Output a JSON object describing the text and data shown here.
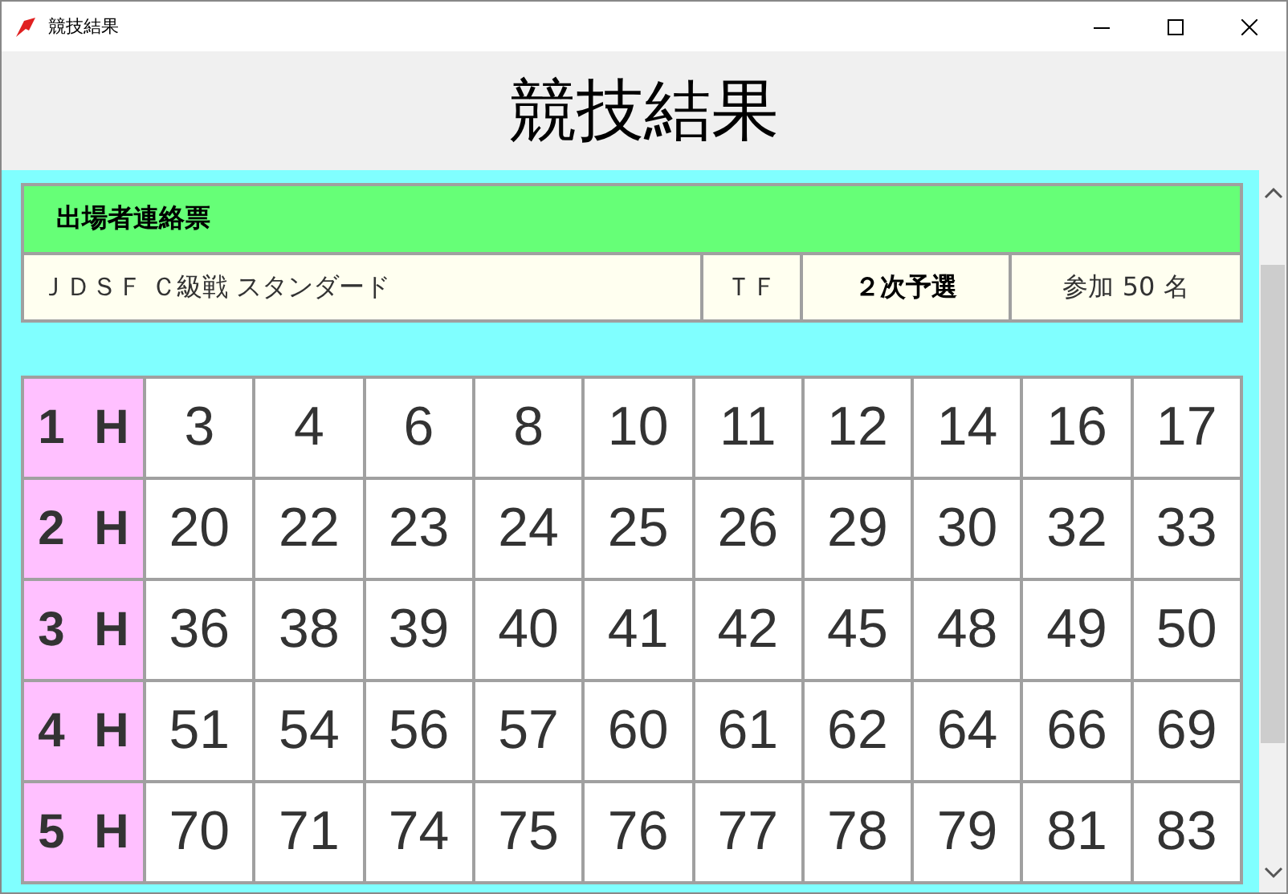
{
  "window": {
    "title": "競技結果"
  },
  "heading": "競技結果",
  "form": {
    "title": "出場者連絡票",
    "event": "ＪＤＳＦ Ｃ級戦 スタンダード",
    "code": "ＴＦ",
    "round": "２次予選",
    "entries": "参加 50 名"
  },
  "heats": [
    {
      "label": "1 H",
      "numbers": [
        "3",
        "4",
        "6",
        "8",
        "10",
        "11",
        "12",
        "14",
        "16",
        "17"
      ]
    },
    {
      "label": "2 H",
      "numbers": [
        "20",
        "22",
        "23",
        "24",
        "25",
        "26",
        "29",
        "30",
        "32",
        "33"
      ]
    },
    {
      "label": "3 H",
      "numbers": [
        "36",
        "38",
        "39",
        "40",
        "41",
        "42",
        "45",
        "48",
        "49",
        "50"
      ]
    },
    {
      "label": "4 H",
      "numbers": [
        "51",
        "54",
        "56",
        "57",
        "60",
        "61",
        "62",
        "64",
        "66",
        "69"
      ]
    },
    {
      "label": "5 H",
      "numbers": [
        "70",
        "71",
        "74",
        "75",
        "76",
        "77",
        "78",
        "79",
        "81",
        "83"
      ]
    }
  ]
}
